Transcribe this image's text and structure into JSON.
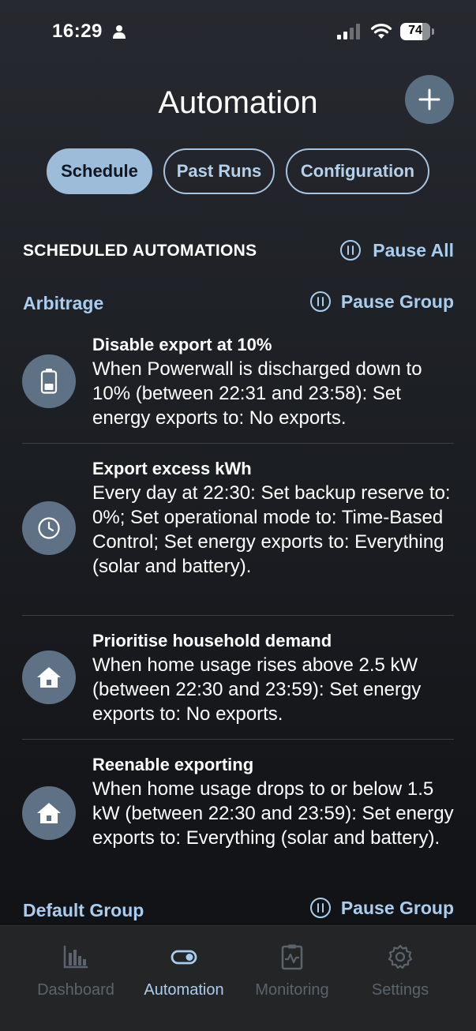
{
  "status_bar": {
    "time": "16:29",
    "battery_level": "74"
  },
  "header": {
    "title": "Automation",
    "add_icon": "plus-icon"
  },
  "tabs": [
    {
      "label": "Schedule",
      "active": true
    },
    {
      "label": "Past Runs",
      "active": false
    },
    {
      "label": "Configuration",
      "active": false
    }
  ],
  "section": {
    "title": "SCHEDULED AUTOMATIONS",
    "pause_all_label": "Pause All"
  },
  "groups": [
    {
      "name": "Arbitrage",
      "pause_label": "Pause Group"
    },
    {
      "name": "Default Group",
      "pause_label": "Pause Group"
    }
  ],
  "automations": [
    {
      "icon": "battery-icon",
      "title": "Disable export at 10%",
      "description": "When Powerwall is discharged down to 10% (between 22:31 and 23:58): Set energy exports to: No exports."
    },
    {
      "icon": "clock-icon",
      "title": "Export excess kWh",
      "description": "Every day at 22:30: Set backup reserve to: 0%; Set operational mode to: Time-Based Control; Set energy exports to: Everything (solar and battery)."
    },
    {
      "icon": "house-icon",
      "title": "Prioritise household demand",
      "description": "When home usage rises above 2.5 kW (between 22:30 and 23:59): Set energy exports to: No exports."
    },
    {
      "icon": "house-icon",
      "title": "Reenable exporting",
      "description": "When home usage drops to or below 1.5 kW (between 22:30 and 23:59): Set energy exports to: Everything (solar and battery)."
    }
  ],
  "nav": [
    {
      "label": "Dashboard",
      "icon": "bar-chart-icon",
      "active": false
    },
    {
      "label": "Automation",
      "icon": "toggle-icon",
      "active": true
    },
    {
      "label": "Monitoring",
      "icon": "clipboard-pulse-icon",
      "active": false
    },
    {
      "label": "Settings",
      "icon": "gear-icon",
      "active": false
    }
  ],
  "colors": {
    "accent": "#a9cdef",
    "tab_active_bg": "#9cbcd9",
    "icon_circle": "#5f7285",
    "add_button": "#5b6f82"
  }
}
